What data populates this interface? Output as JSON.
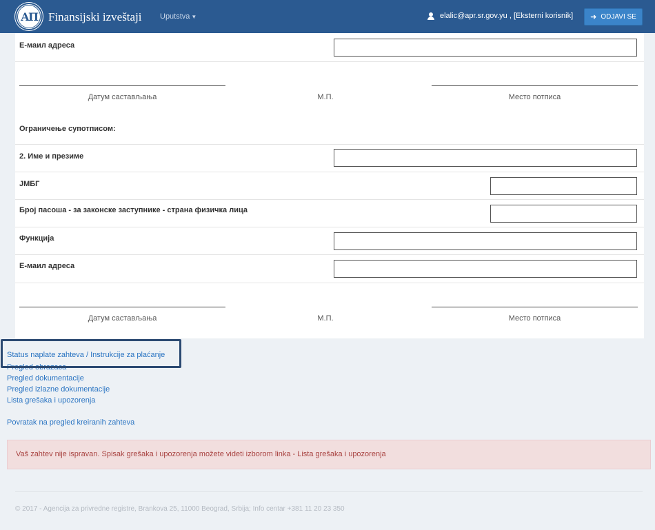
{
  "navbar": {
    "brand": "Finansijski izveštaji",
    "menu": "Uputstva",
    "user": "elalic@apr.sr.gov.yu , [Eksterni korisnik]",
    "logout": "ODJAVI SE"
  },
  "form": {
    "email_label_top": "Е-маил адреса",
    "signature_block_1": {
      "date": "Датум састављања",
      "stamp": "М.П.",
      "place": "Место потписа"
    },
    "restriction_label": "Ограничење супотписом:",
    "fields": [
      {
        "label": "2. Име и презиме",
        "value": ""
      },
      {
        "label": "ЈМБГ",
        "value": ""
      },
      {
        "label": "Број пасоша - за законске заступнике - страна физичка лица",
        "value": ""
      },
      {
        "label": "Функција",
        "value": ""
      },
      {
        "label": "Е-маил адреса",
        "value": ""
      }
    ],
    "signature_block_2": {
      "date": "Датум састављања",
      "stamp": "М.П.",
      "place": "Место потписа"
    }
  },
  "links": [
    "Status naplate zahteva / Instrukcije za plaćanje",
    "Pregled obrazaca",
    "Pregled dokumentacije",
    "Pregled izlazne dokumentacije",
    "Lista grešaka i upozorenja"
  ],
  "back_link": "Povratak na pregled kreiranih zahteva",
  "alert": "Vaš zahtev nije ispravan. Spisak grešaka i upozorenja možete videti izborom linka - Lista grešaka i upozorenja",
  "footer": "© 2017 - Agencija za privredne registre, Brankova 25, 11000 Beograd, Srbija; Info centar +381 11 20 23 350",
  "colors": {
    "navbar": "#2b5a91",
    "logout_button": "#3b84c9",
    "link": "#2a74c2",
    "alert_bg": "#f2dede",
    "alert_text": "#a94442"
  }
}
